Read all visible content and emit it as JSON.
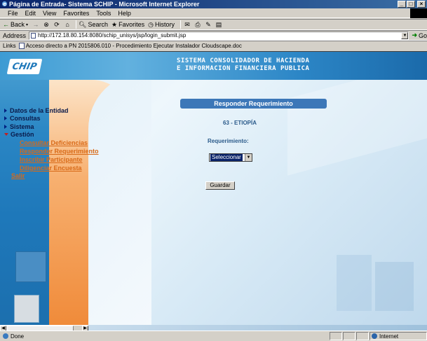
{
  "window": {
    "title": "Página de Entrada- Sistema SCHIP - Microsoft Internet Explorer",
    "controls": [
      "_",
      "□",
      "×"
    ]
  },
  "menu": [
    "File",
    "Edit",
    "View",
    "Favorites",
    "Tools",
    "Help"
  ],
  "toolbar": {
    "back": "Back",
    "search": "Search",
    "favorites": "Favorites",
    "history": "History"
  },
  "address": {
    "label": "Address",
    "url": "http://172.18.80.154:8080/schip_unisys/jsp/login_submit.jsp",
    "go": "Go"
  },
  "links": {
    "label": "Links",
    "item": "Acceso directo a PN 2015806.010 - Procedimiento Ejecutar Instalador Cloudscape.doc"
  },
  "header": {
    "logo": "CHIP",
    "title_line1": "SISTEMA CONSOLIDADOR DE HACIENDA",
    "title_line2": "E INFORMACION FINANCIERA PUBLICA"
  },
  "nav": {
    "items": [
      "Datos de la Entidad",
      "Consultas",
      "Sistema",
      "Gestión"
    ],
    "gestion_sub": [
      "Consultar Deficiencias",
      "Responder Requerimiento",
      "Inscribir Participante",
      "Diligenciar Encuesta"
    ],
    "salir": "Salir"
  },
  "form": {
    "title": "Responder Requerimiento",
    "entity": "63 - ETIOPÍA",
    "req_label": "Requerimiento:",
    "select_value": "Seleccionar",
    "save_button": "Guardar"
  },
  "status": {
    "text": "Done",
    "zone": "Internet"
  },
  "colors": {
    "accent": "#3c77b8",
    "nav_link": "#d86a18",
    "titlebar": "#0a246a"
  }
}
